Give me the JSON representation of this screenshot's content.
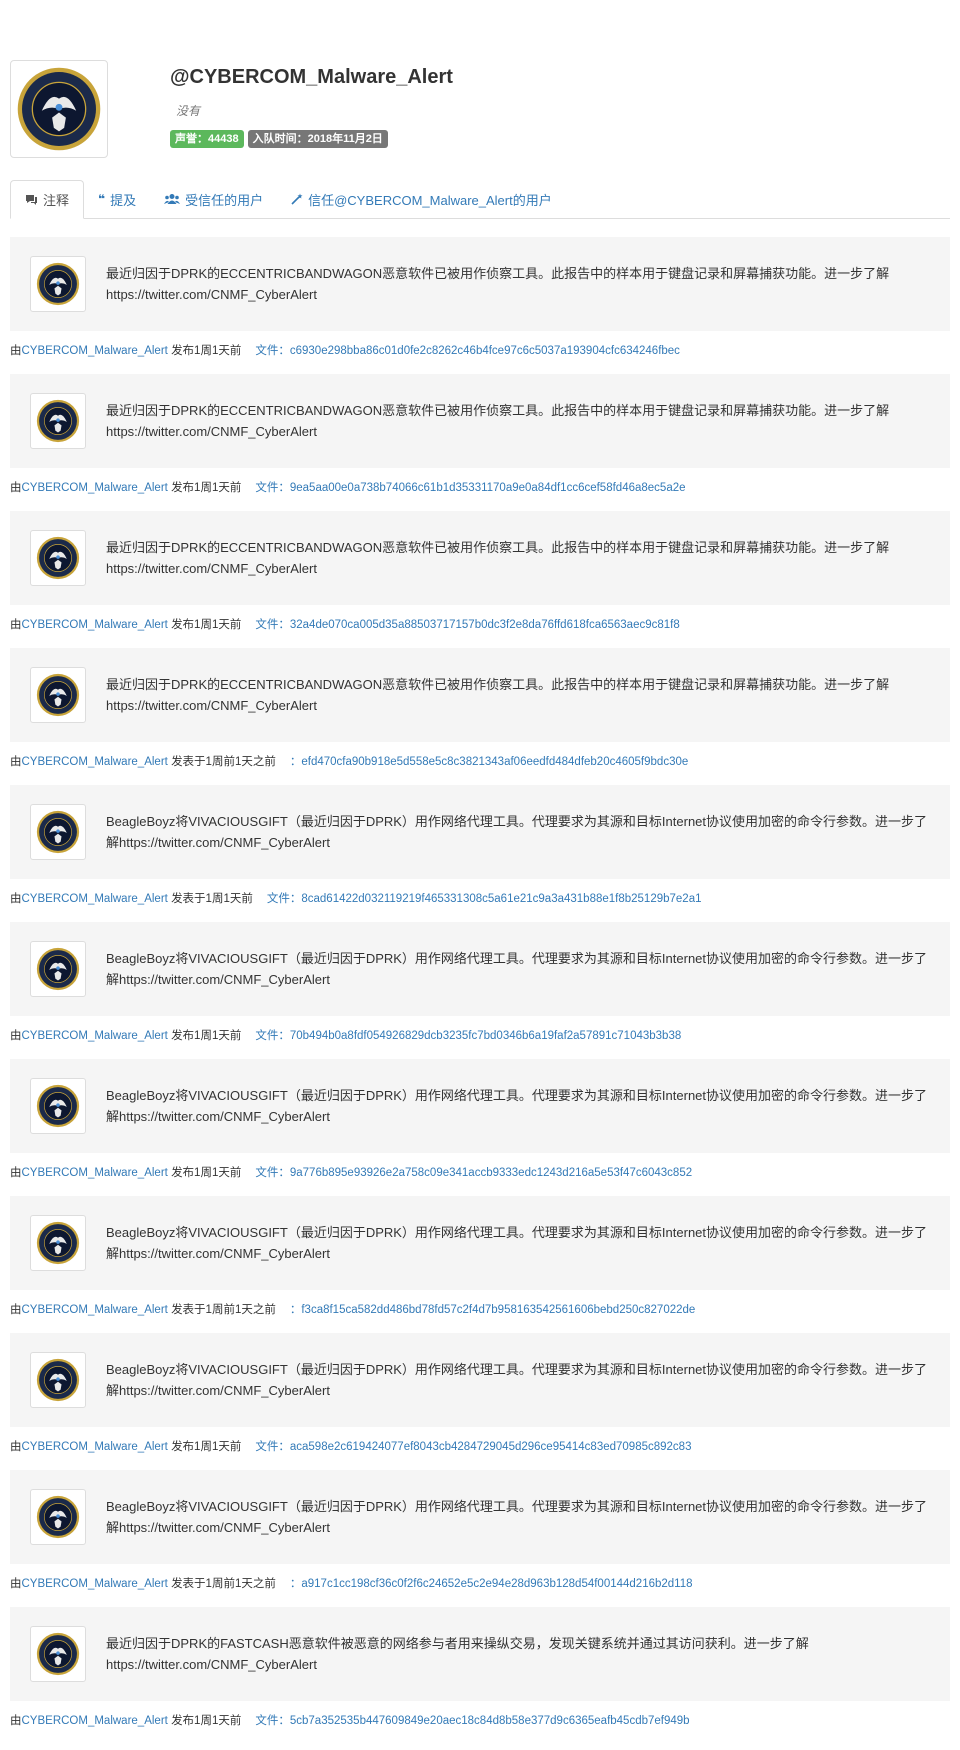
{
  "profile": {
    "name": "@CYBERCOM_Malware_Alert",
    "description": "没有",
    "reputation_badge": "声誉：44438",
    "joined_badge": "入队时间：2018年11月2日",
    "avatar_icon": "cybercom-seal-logo",
    "avatar_logo_text": "UNITED STATES CYBER COMMAND"
  },
  "tabs": [
    {
      "label": "注释",
      "icon": "comments-icon",
      "active": true
    },
    {
      "label": "提及",
      "icon": "quote-icon",
      "active": false
    },
    {
      "label": "受信任的用户",
      "icon": "users-icon",
      "active": false
    },
    {
      "label": "信任@CYBERCOM_Malware_Alert的用户",
      "icon": "magic-wand-icon",
      "active": false
    }
  ],
  "comments": [
    {
      "text": "最近归因于DPRK的ECCENTRICBANDWAGON恶意软件已被用作侦察工具。此报告中的样本用于键盘记录和屏幕捕获功能。进一步了解https://twitter.com/CNMF_CyberAlert",
      "by_prefix": "由",
      "author": "CYBERCOM_Malware_Alert",
      "posted": "发布1周1天前",
      "file_label": "文件：",
      "file_hash": "c6930e298bba86c01d0fe2c8262c46b4fce97c6c5037a193904cfc634246fbec"
    },
    {
      "text": "最近归因于DPRK的ECCENTRICBANDWAGON恶意软件已被用作侦察工具。此报告中的样本用于键盘记录和屏幕捕获功能。进一步了解https://twitter.com/CNMF_CyberAlert",
      "by_prefix": "由",
      "author": "CYBERCOM_Malware_Alert",
      "posted": "发布1周1天前",
      "file_label": "文件：",
      "file_hash": "9ea5aa00e0a738b74066c61b1d35331170a9e0a84df1cc6cef58fd46a8ec5a2e"
    },
    {
      "text": "最近归因于DPRK的ECCENTRICBANDWAGON恶意软件已被用作侦察工具。此报告中的样本用于键盘记录和屏幕捕获功能。进一步了解https://twitter.com/CNMF_CyberAlert",
      "by_prefix": "由",
      "author": "CYBERCOM_Malware_Alert",
      "posted": "发布1周1天前",
      "file_label": "文件：",
      "file_hash": "32a4de070ca005d35a88503717157b0dc3f2e8da76ffd618fca6563aec9c81f8"
    },
    {
      "text": "最近归因于DPRK的ECCENTRICBANDWAGON恶意软件已被用作侦察工具。此报告中的样本用于键盘记录和屏幕捕获功能。进一步了解https://twitter.com/CNMF_CyberAlert",
      "by_prefix": "由",
      "author": "CYBERCOM_Malware_Alert",
      "posted": "发表于1周前1天之前",
      "file_label": "：",
      "file_hash": "efd470cfa90b918e5d558e5c8c3821343af06eedfd484dfeb20c4605f9bdc30e"
    },
    {
      "text": "BeagleBoyz将VIVACIOUSGIFT（最近归因于DPRK）用作网络代理工具。代理要求为其源和目标Internet协议使用加密的命令行参数。进一步了解https://twitter.com/CNMF_CyberAlert",
      "by_prefix": "由",
      "author": "CYBERCOM_Malware_Alert",
      "posted": "发表于1周1天前",
      "file_label": "文件：",
      "file_hash": "8cad61422d032119219f465331308c5a61e21c9a3a431b88e1f8b25129b7e2a1"
    },
    {
      "text": "BeagleBoyz将VIVACIOUSGIFT（最近归因于DPRK）用作网络代理工具。代理要求为其源和目标Internet协议使用加密的命令行参数。进一步了解https://twitter.com/CNMF_CyberAlert",
      "by_prefix": "由",
      "author": "CYBERCOM_Malware_Alert",
      "posted": "发布1周1天前",
      "file_label": "文件：",
      "file_hash": "70b494b0a8fdf054926829dcb3235fc7bd0346b6a19faf2a57891c71043b3b38"
    },
    {
      "text": "BeagleBoyz将VIVACIOUSGIFT（最近归因于DPRK）用作网络代理工具。代理要求为其源和目标Internet协议使用加密的命令行参数。进一步了解https://twitter.com/CNMF_CyberAlert",
      "by_prefix": "由",
      "author": "CYBERCOM_Malware_Alert",
      "posted": "发布1周1天前",
      "file_label": "文件：",
      "file_hash": "9a776b895e93926e2a758c09e341accb9333edc1243d216a5e53f47c6043c852"
    },
    {
      "text": "BeagleBoyz将VIVACIOUSGIFT（最近归因于DPRK）用作网络代理工具。代理要求为其源和目标Internet协议使用加密的命令行参数。进一步了解https://twitter.com/CNMF_CyberAlert",
      "by_prefix": "由",
      "author": "CYBERCOM_Malware_Alert",
      "posted": "发表于1周前1天之前",
      "file_label": "：",
      "file_hash": "f3ca8f15ca582dd486bd78fd57c2f4d7b958163542561606bebd250c827022de"
    },
    {
      "text": "BeagleBoyz将VIVACIOUSGIFT（最近归因于DPRK）用作网络代理工具。代理要求为其源和目标Internet协议使用加密的命令行参数。进一步了解https://twitter.com/CNMF_CyberAlert",
      "by_prefix": "由",
      "author": "CYBERCOM_Malware_Alert",
      "posted": "发布1周1天前",
      "file_label": "文件：",
      "file_hash": "aca598e2c619424077ef8043cb4284729045d296ce95414c83ed70985c892c83"
    },
    {
      "text": "BeagleBoyz将VIVACIOUSGIFT（最近归因于DPRK）用作网络代理工具。代理要求为其源和目标Internet协议使用加密的命令行参数。进一步了解https://twitter.com/CNMF_CyberAlert",
      "by_prefix": "由",
      "author": "CYBERCOM_Malware_Alert",
      "posted": "发表于1周前1天之前",
      "file_label": "：",
      "file_hash": "a917c1cc198cf36c0f2f6c24652e5c2e94e28d963b128d54f00144d216b2d118"
    },
    {
      "text": "最近归因于DPRK的FASTCASH恶意软件被恶意的网络参与者用来操纵交易，发现关键系统并通过其访问获利。进一步了解https://twitter.com/CNMF_CyberAlert",
      "by_prefix": "由",
      "author": "CYBERCOM_Malware_Alert",
      "posted": "发布1周1天前",
      "file_label": "文件：",
      "file_hash": "5cb7a352535b447609849e20aec18c84d8b58e377d9c6365eafb45cdb7ef949b"
    }
  ],
  "colors": {
    "link": "#337ab7",
    "badge_green": "#5cb85c",
    "badge_gray": "#777777",
    "card_bg": "#f5f5f5"
  }
}
